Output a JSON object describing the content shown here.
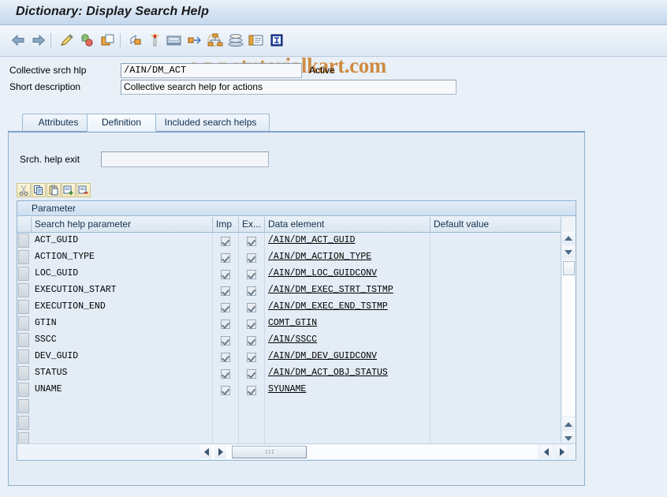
{
  "window": {
    "title": "Dictionary: Display Search Help"
  },
  "toolbar": {
    "buttons": [
      {
        "name": "back-arrow-icon",
        "label": "Back"
      },
      {
        "name": "forward-arrow-icon",
        "label": "Forward"
      },
      {
        "name": "pencil-change-icon",
        "label": "Display <-> Change"
      },
      {
        "name": "activate-icon",
        "label": "Activate"
      },
      {
        "name": "other-object-icon",
        "label": "Other object"
      },
      {
        "name": "display-object-list-icon",
        "label": "Display object list"
      },
      {
        "name": "test-icon",
        "label": "Test"
      },
      {
        "name": "print-preview-icon",
        "label": "Print preview"
      },
      {
        "name": "where-used-list-icon",
        "label": "Where-used list"
      },
      {
        "name": "hierarchy-icon",
        "label": "Hierarchy"
      },
      {
        "name": "runtime-object-icon",
        "label": "Runtime object"
      },
      {
        "name": "documentation-icon",
        "label": "Documentation"
      },
      {
        "name": "technical-info-icon",
        "label": "Technical information"
      }
    ],
    "watermark": "www.tutorialkart.com"
  },
  "header": {
    "collective_label": "Collective srch hlp",
    "collective_value": "/AIN/DM_ACT",
    "status": "Active",
    "short_desc_label": "Short description",
    "short_desc_value": "Collective search help for actions"
  },
  "tabs": [
    {
      "label": "Attributes",
      "selected": false
    },
    {
      "label": "Definition",
      "selected": true
    },
    {
      "label": "Included search helps",
      "selected": false
    }
  ],
  "definition": {
    "exit_label": "Srch. help exit",
    "exit_value": "",
    "exit_placeholder": ""
  },
  "table_toolbar": [
    {
      "name": "cut-icon",
      "label": "Cut"
    },
    {
      "name": "copy-icon",
      "label": "Copy"
    },
    {
      "name": "paste-icon",
      "label": "Paste"
    },
    {
      "name": "insert-row-icon",
      "label": "Insert row"
    },
    {
      "name": "delete-row-icon",
      "label": "Delete row"
    }
  ],
  "grid": {
    "title": "Parameter",
    "columns": [
      {
        "key": "param",
        "label": "Search help parameter"
      },
      {
        "key": "imp",
        "label": "Imp"
      },
      {
        "key": "exp",
        "label": "Ex..."
      },
      {
        "key": "data_element",
        "label": "Data element"
      },
      {
        "key": "default_value",
        "label": "Default value"
      }
    ],
    "rows": [
      {
        "param": "ACT_GUID",
        "imp": true,
        "exp": true,
        "data_element": "/AIN/DM_ACT_GUID",
        "default_value": ""
      },
      {
        "param": "ACTION_TYPE",
        "imp": true,
        "exp": true,
        "data_element": "/AIN/DM_ACTION_TYPE",
        "default_value": ""
      },
      {
        "param": "LOC_GUID",
        "imp": true,
        "exp": true,
        "data_element": "/AIN/DM_LOC_GUIDCONV",
        "default_value": ""
      },
      {
        "param": "EXECUTION_START",
        "imp": true,
        "exp": true,
        "data_element": "/AIN/DM_EXEC_STRT_TSTMP",
        "default_value": ""
      },
      {
        "param": "EXECUTION_END",
        "imp": true,
        "exp": true,
        "data_element": "/AIN/DM_EXEC_END_TSTMP",
        "default_value": ""
      },
      {
        "param": "GTIN",
        "imp": true,
        "exp": true,
        "data_element": "COMT_GTIN",
        "default_value": ""
      },
      {
        "param": "SSCC",
        "imp": true,
        "exp": true,
        "data_element": "/AIN/SSCC",
        "default_value": ""
      },
      {
        "param": "DEV_GUID",
        "imp": true,
        "exp": true,
        "data_element": "/AIN/DM_DEV_GUIDCONV",
        "default_value": ""
      },
      {
        "param": "STATUS",
        "imp": true,
        "exp": true,
        "data_element": "/AIN/DM_ACT_OBJ_STATUS",
        "default_value": ""
      },
      {
        "param": "UNAME",
        "imp": true,
        "exp": true,
        "data_element": "SYUNAME",
        "default_value": ""
      },
      {
        "param": "",
        "imp": null,
        "exp": null,
        "data_element": "",
        "default_value": ""
      },
      {
        "param": "",
        "imp": null,
        "exp": null,
        "data_element": "",
        "default_value": ""
      },
      {
        "param": "",
        "imp": null,
        "exp": null,
        "data_element": "",
        "default_value": ""
      }
    ],
    "config_icon": "grid-settings-icon"
  },
  "colors": {
    "window_bg": "#e9f0f7",
    "title_bar": "#d4e3f2",
    "panel_bg": "#e4edf6",
    "row_bg": "#e4edf6",
    "accent_border": "#8fb0cd",
    "watermark": "#c8761c"
  }
}
